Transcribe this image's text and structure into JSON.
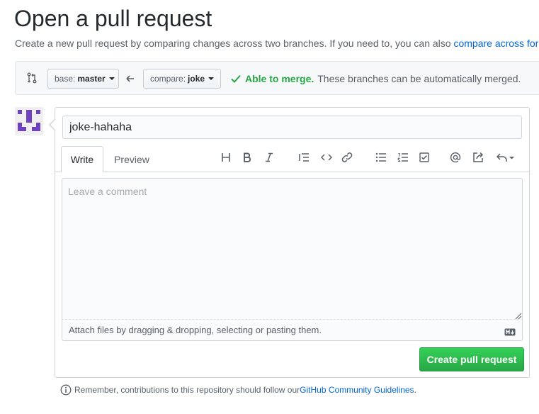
{
  "header": {
    "title": "Open a pull request",
    "subtitle_text": "Create a new pull request by comparing changes across two branches. If you need to, you can also ",
    "subtitle_link": "compare across forks"
  },
  "range": {
    "base_prefix": "base:",
    "base_branch": "master",
    "compare_prefix": "compare:",
    "compare_branch": "joke",
    "merge_ok": "Able to merge.",
    "merge_text": "These branches can be automatically merged."
  },
  "form": {
    "title_value": "joke-hahaha",
    "tabs": [
      "Write",
      "Preview"
    ],
    "comment_placeholder": "Leave a comment",
    "attach_text": "Attach files by dragging & dropping, selecting or pasting them.",
    "submit_label": "Create pull request"
  },
  "toolbar_icons": [
    "header-icon",
    "bold-icon",
    "italic-icon",
    "quote-icon",
    "code-icon",
    "link-icon",
    "unordered-list-icon",
    "ordered-list-icon",
    "task-list-icon",
    "mention-icon",
    "reference-icon",
    "reply-icon"
  ],
  "footer": {
    "text": "Remember, contributions to this repository should follow our ",
    "link": "GitHub Community Guidelines",
    "end": "."
  },
  "colors": {
    "accent_link": "#0366d6",
    "success": "#28a745",
    "avatar": "#6f42c1"
  }
}
